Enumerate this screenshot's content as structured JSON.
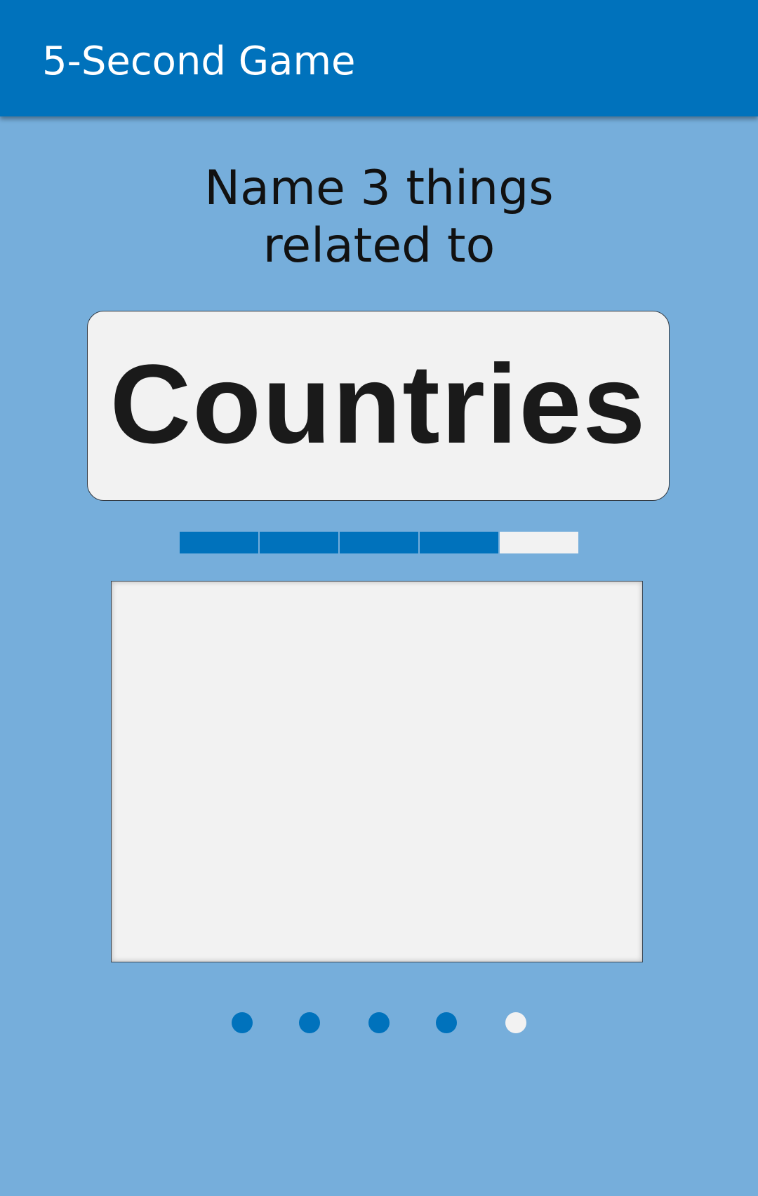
{
  "app_bar": {
    "title": "5-Second Game"
  },
  "prompt": {
    "line1": "Name 3 things",
    "line2": "related to"
  },
  "topic": {
    "word": "Countries"
  },
  "timer": {
    "total_segments": 5,
    "filled_segments": 4
  },
  "answer_area": {
    "value": ""
  },
  "pager": {
    "total": 5,
    "completed": 4
  },
  "colors": {
    "primary": "#0072BC",
    "background": "#76AEDB",
    "surface": "#F2F2F2",
    "text": "#1A1A1A"
  }
}
